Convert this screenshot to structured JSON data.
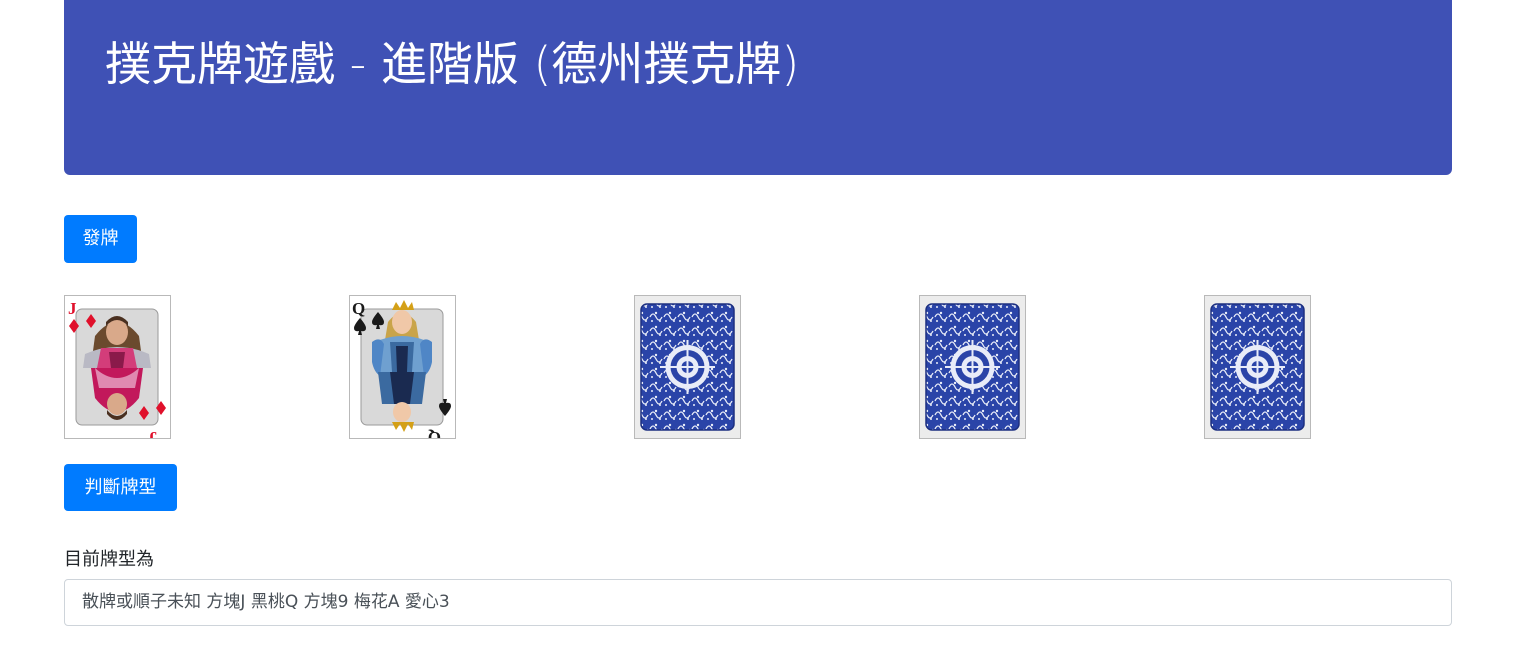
{
  "header": {
    "title": "撲克牌遊戲 - 進階版 (德州撲克牌)",
    "background_color": "#3f51b5"
  },
  "deal_button": {
    "label": "發牌"
  },
  "cards": [
    {
      "state": "face-up",
      "rank": "J",
      "suit": "diamond",
      "suit_color": "#e0102b"
    },
    {
      "state": "face-up",
      "rank": "Q",
      "suit": "spade",
      "suit_color": "#1a1a1a"
    },
    {
      "state": "face-down"
    },
    {
      "state": "face-down"
    },
    {
      "state": "face-down"
    }
  ],
  "judge_button": {
    "label": "判斷牌型"
  },
  "result": {
    "label": "目前牌型為",
    "value": "散牌或順子未知 方塊J 黑桃Q 方塊9 梅花A 愛心3"
  },
  "colors": {
    "button": "#007bff",
    "card_back": "#2a44a8"
  }
}
